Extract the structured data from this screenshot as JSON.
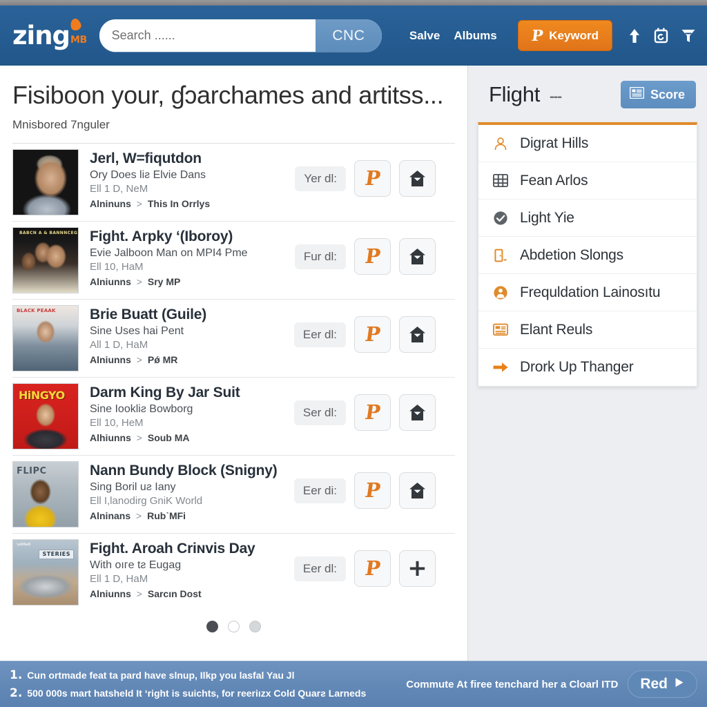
{
  "header": {
    "logo_word": "zing",
    "logo_badge": "MB",
    "logo_flame_icon": "flame-icon",
    "search": {
      "placeholder": "Search ......",
      "value": "",
      "submit_label": "CNC"
    },
    "nav": [
      {
        "label": "Salve"
      },
      {
        "label": "Albums"
      }
    ],
    "keyword_button": {
      "label": "Keyword",
      "glyph": "P",
      "color": "#f0891f"
    },
    "icons": [
      {
        "name": "upload-arrow-icon"
      },
      {
        "name": "calendar-icon"
      },
      {
        "name": "filter-icon"
      }
    ]
  },
  "main": {
    "title": "Fisiboon your, ɠɔarchames and artitss...",
    "subtitle": "Mnisbored 7nguler",
    "crumb_root": "Alniunns",
    "crumb_sep": ">",
    "results": [
      {
        "title": "Jerl, W=fiqutdon",
        "subtitle": "Ory Does liƨ Elvie Dans",
        "meta": "Ell 1 D, NeM",
        "crumb_root": "Alninuns",
        "crumb_leaf": "This In Orrlys",
        "dl_label": "Yer dl:",
        "actions": [
          "p-glyph-icon",
          "home-mail-icon"
        ],
        "thumb_class": "th-1",
        "thumb_caption": ""
      },
      {
        "title": "Fight. Arpky ʻ(Iboroy)",
        "subtitle": "Evie Jalboon Man on MPI4 Pme",
        "meta": "Ell 10, HaM",
        "crumb_root": "Alniunns",
        "crumb_leaf": "Sry MP",
        "dl_label": "Fur dl:",
        "actions": [
          "p-glyph-icon",
          "home-mail-icon"
        ],
        "thumb_class": "th-2",
        "thumb_caption": "BABCN A & BANNNCEG"
      },
      {
        "title": "Brie Buatt (Guile)",
        "subtitle": "Sine Uses hai Pent",
        "meta": "All 1 D, HaM",
        "crumb_root": "Alniunns",
        "crumb_leaf": "Pǿ MR",
        "dl_label": "Eer dl:",
        "actions": [
          "p-glyph-icon",
          "home-mail-icon"
        ],
        "thumb_class": "th-3",
        "thumb_caption": "BLACK PEAAK"
      },
      {
        "title": "Darm King By Jar Suit",
        "subtitle": "Sine Iookliƨ Bowborg",
        "meta": "Ell 10, HeM",
        "crumb_root": "Alhiunns",
        "crumb_leaf": "Soub MA",
        "dl_label": "Ser dl:",
        "actions": [
          "p-glyph-icon",
          "home-mail-icon"
        ],
        "thumb_class": "th-4",
        "thumb_caption": "HiNGYO"
      },
      {
        "title": "Nann Bundy Block (Snigny)",
        "subtitle": "Sing Boril uƨ Iany",
        "meta": "Ell I,lanodirg GniK World",
        "crumb_root": "Alninans",
        "crumb_leaf": "Rub˙MFi",
        "dl_label": "Eer di:",
        "actions": [
          "p-glyph-icon",
          "home-mail-icon"
        ],
        "thumb_class": "th-5",
        "thumb_caption": "FLIPC"
      },
      {
        "title": "Fight. Aroah Criɴvis Day",
        "subtitle": "With oıгe tƨ Euɡaɡ",
        "meta": "Ell 1 D, HaM",
        "crumb_root": "Alniunns",
        "crumb_leaf": "Sarcın Dost",
        "dl_label": "Eer dl:",
        "actions": [
          "p-glyph-icon",
          "plus-icon"
        ],
        "thumb_class": "th-6",
        "thumb_caption": "STERIES"
      }
    ],
    "pagination": {
      "pages": 3,
      "active": 1
    }
  },
  "panel": {
    "title": "Flight",
    "dash": "---",
    "score_button": {
      "label": "Score",
      "icon": "list-lines-icon"
    },
    "accent_color": "#e08b2b",
    "items": [
      {
        "label": "Digrat Hills",
        "icon": "user-outline-icon"
      },
      {
        "label": "Fean Arlos",
        "icon": "grid-table-icon"
      },
      {
        "label": "Light Yie",
        "icon": "check-circle-icon"
      },
      {
        "label": "Abdetion Slongs",
        "icon": "door-icon"
      },
      {
        "label": "Frequldation Lainosıtu",
        "icon": "user-circle-icon"
      },
      {
        "label": "Elant Reuls",
        "icon": "card-stack-icon"
      },
      {
        "label": "Drork Up Thanger",
        "icon": "arrow-right-icon"
      }
    ]
  },
  "footer": {
    "lines": [
      {
        "num": "1.",
        "text": "Cun ortmade feat ta pard have slnup, Ilkp you lasfal Yau Jl"
      },
      {
        "num": "2.",
        "text": "500 000s mart hatsheld It ʻright is suichts, for reeriızx Cold Quarƨ Larneds"
      }
    ],
    "note": "Commute At firee tenchard her a Cloarl ITD",
    "button": {
      "label": "Red",
      "icon": "play-triangle-icon"
    }
  }
}
